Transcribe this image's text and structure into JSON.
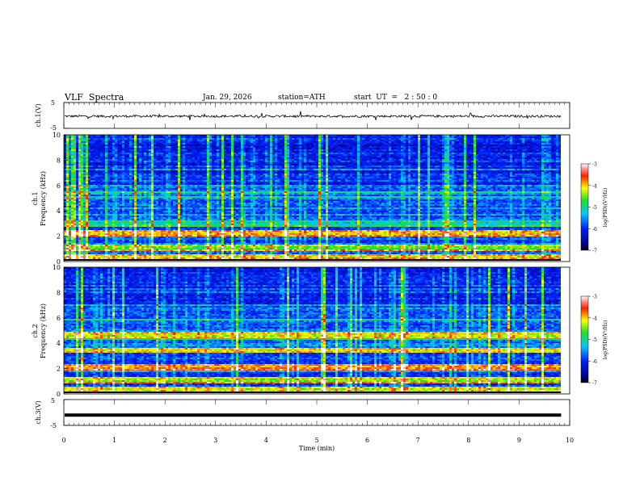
{
  "header": {
    "title": "VLF  Spectra",
    "date": "Jan. 29, 2026",
    "station": "station=ATH",
    "start_ut": "start  UT  =   2 : 50 : 0"
  },
  "chart_data": [
    {
      "type": "line",
      "ylabel": "ch.1(V)",
      "ylim": [
        -5,
        5
      ],
      "yticks": [
        "5",
        "-5"
      ],
      "xlim": [
        0,
        10
      ],
      "description_values": "waveform near -0.3 V with small fluctuations and occasional spikes",
      "baseline": -0.3,
      "color": "#000000"
    },
    {
      "type": "heatmap",
      "ylabel": "ch.1\nFrequency (kHz)",
      "ylim": [
        0,
        10
      ],
      "yticks": [
        "0",
        "2",
        "4",
        "6",
        "8",
        "10"
      ],
      "xlim": [
        0,
        9.83
      ],
      "colorbar": {
        "label": "log(PSD)(V²/Hz)",
        "ticks": [
          "-3",
          "-4",
          "-5",
          "-6",
          "-7"
        ],
        "range": [
          -7,
          -3
        ]
      },
      "bands": [
        {
          "freq_khz": 2.2,
          "log_psd": -4.2
        },
        {
          "freq_khz": 1.0,
          "log_psd": -4.8
        },
        {
          "freq_khz": 3.0,
          "log_psd": -5.3
        },
        {
          "freq_khz": 0.2,
          "log_psd": -4.5
        }
      ]
    },
    {
      "type": "heatmap",
      "ylabel": "ch.2\nFrequency (kHz)",
      "ylim": [
        0,
        10
      ],
      "yticks": [
        "0",
        "2",
        "4",
        "6",
        "8",
        "10"
      ],
      "xlim": [
        0,
        9.83
      ],
      "colorbar": {
        "label": "log(PSD)(V²/Hz)",
        "ticks": [
          "-3",
          "-4",
          "-5",
          "-6",
          "-7"
        ],
        "range": [
          -7,
          -3
        ]
      },
      "bands": [
        {
          "freq_khz": 2.1,
          "log_psd": -4.0
        },
        {
          "freq_khz": 3.4,
          "log_psd": -4.3
        },
        {
          "freq_khz": 4.6,
          "log_psd": -4.4
        },
        {
          "freq_khz": 1.0,
          "log_psd": -4.6
        },
        {
          "freq_khz": 0.3,
          "log_psd": -4.4
        }
      ]
    },
    {
      "type": "line",
      "ylabel": "ch.3(V)",
      "ylim": [
        -5,
        5
      ],
      "yticks": [
        "5",
        "-5"
      ],
      "xlim": [
        0,
        10
      ],
      "baseline": -1.0,
      "color": "#000000"
    }
  ],
  "xaxis": {
    "label": "Time  (min)",
    "ticks": [
      "0",
      "1",
      "2",
      "3",
      "4",
      "5",
      "6",
      "7",
      "8",
      "9",
      "10"
    ]
  }
}
